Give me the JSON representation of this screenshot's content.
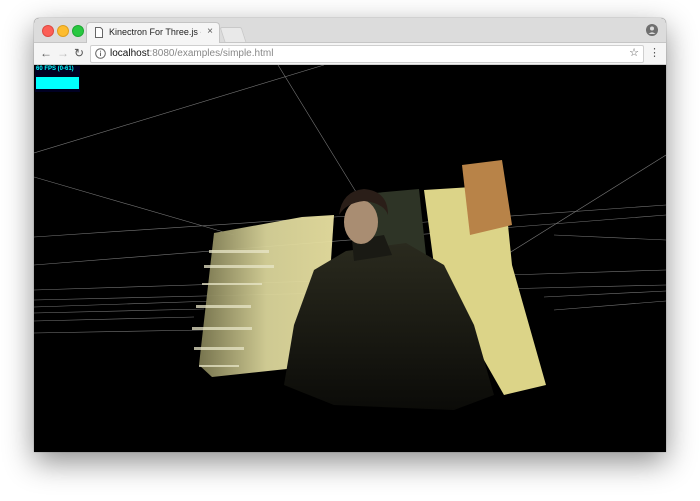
{
  "browser": {
    "tab_title": "Kinectron For Three.js - Simple",
    "tab_close": "×",
    "url_host": "localhost",
    "url_rest": ":8080/examples/simple.html",
    "back": "←",
    "forward": "→",
    "reload": "↻",
    "star": "☆",
    "menu": "⋮"
  },
  "stats": {
    "fps_label": "60 FPS (0-61)",
    "graph_color": "#00ffff"
  },
  "scene": {
    "background": "#000000",
    "grid_color": "#9a9a9a",
    "content": "point-cloud-person-in-chair"
  }
}
